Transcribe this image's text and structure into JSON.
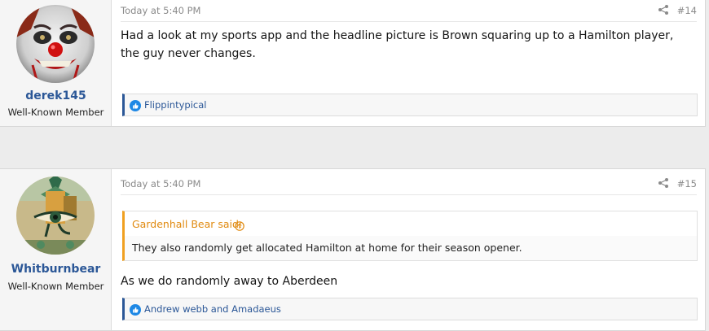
{
  "posts": [
    {
      "username": "derek145",
      "user_title": "Well-Known Member",
      "time": "Today at 5:40 PM",
      "post_number": "#14",
      "body": "Had a look at my sports app and the headline picture is Brown squaring up to a Hamilton player, the guy never changes.",
      "reactions": "Flippintypical"
    },
    {
      "username": "Whitburnbear",
      "user_title": "Well-Known Member",
      "time": "Today at 5:40 PM",
      "post_number": "#15",
      "quote_author": "Gardenhall Bear said:",
      "quote_text": "They also randomly get allocated Hamilton at home for their season opener.",
      "body": "As we do randomly away to Aberdeen",
      "reactions": "Andrew webb and Amadaeus"
    }
  ],
  "icons": {
    "share": "share-icon",
    "like": "like-icon",
    "quote_jump": "arrow-up-circle-icon"
  },
  "colors": {
    "username": "#2b5797",
    "quote_accent": "#e08a10",
    "like_blue": "#1e88e5"
  }
}
